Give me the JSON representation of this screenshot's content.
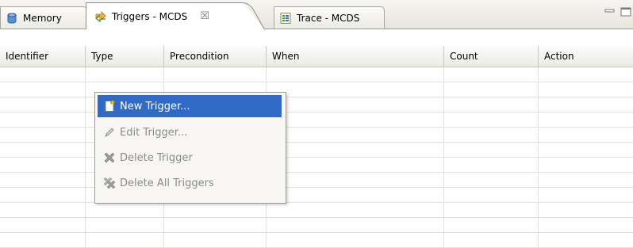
{
  "tabs": [
    {
      "label": "Memory"
    },
    {
      "label": "Triggers - MCDS",
      "close": "☒"
    },
    {
      "label": "Trace - MCDS"
    }
  ],
  "table": {
    "columns": [
      "Identifier",
      "Type",
      "Precondition",
      "When",
      "Count",
      "Action"
    ]
  },
  "context_menu": {
    "items": [
      {
        "label": "New Trigger...",
        "icon": "new-document-icon",
        "state": "active"
      },
      {
        "label": "Edit Trigger...",
        "icon": "pencil-icon",
        "state": "disabled"
      },
      {
        "label": "Delete Trigger",
        "icon": "delete-x-icon",
        "state": "disabled"
      },
      {
        "label": "Delete All Triggers",
        "icon": "delete-all-icon",
        "state": "disabled"
      }
    ]
  },
  "colors": {
    "selection": "#316ac5",
    "disabled_text": "#8b8b88"
  }
}
